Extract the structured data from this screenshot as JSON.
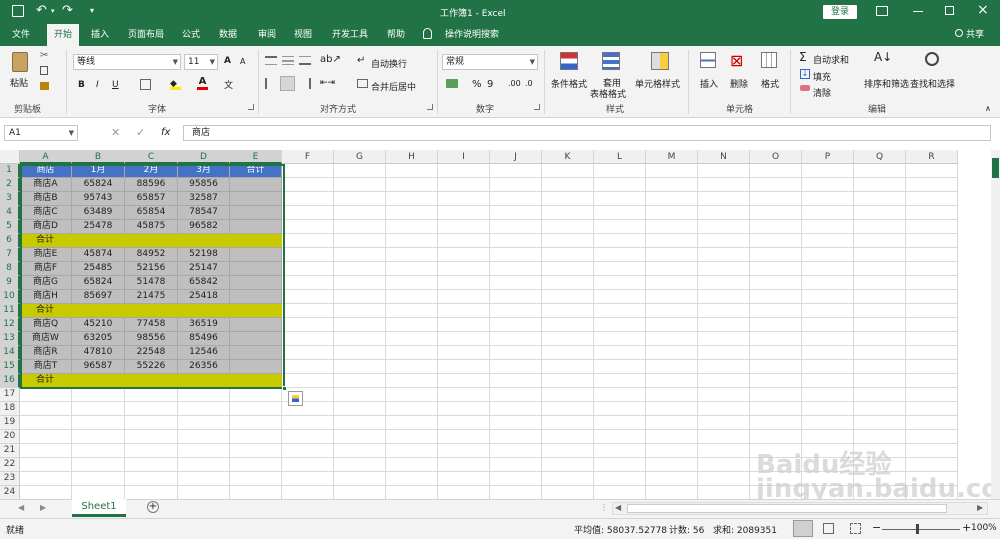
{
  "window": {
    "title": "工作簿1 - Excel",
    "login_label": "登录"
  },
  "ribbon_tabs": [
    "文件",
    "开始",
    "插入",
    "页面布局",
    "公式",
    "数据",
    "审阅",
    "视图",
    "开发工具",
    "帮助"
  ],
  "tell_me": "操作说明搜索",
  "share_label": "共享",
  "clipboard": {
    "paste": "粘贴",
    "group": "剪贴板"
  },
  "font": {
    "name": "等线",
    "size": "11",
    "group": "字体",
    "bold": "B",
    "italic": "I",
    "underline": "U",
    "grow": "A",
    "shrink": "A"
  },
  "alignment": {
    "wrap": "自动换行",
    "merge": "合并后居中",
    "group": "对齐方式"
  },
  "number": {
    "format": "常规",
    "percent": "%",
    "comma": "9",
    "group": "数字"
  },
  "styles": {
    "conditional": "条件格式",
    "table1": "套用",
    "table2": "表格格式",
    "cell": "单元格样式",
    "group": "样式"
  },
  "cells": {
    "insert": "插入",
    "delete": "删除",
    "format": "格式",
    "group": "单元格"
  },
  "editing": {
    "autosum": "自动求和",
    "fill": "填充",
    "clear": "清除",
    "sort": "排序和筛选",
    "find": "查找和选择",
    "group": "编辑"
  },
  "formula_bar": {
    "name_box": "A1",
    "fx": "fx",
    "content": "商店"
  },
  "columns": [
    "A",
    "B",
    "C",
    "D",
    "E",
    "F",
    "G",
    "H",
    "I",
    "J",
    "K",
    "L",
    "M",
    "N",
    "O",
    "P",
    "Q",
    "R"
  ],
  "rows": [
    {
      "n": "1",
      "cells": [
        "商店",
        "1月",
        "2月",
        "3月",
        "合计"
      ],
      "kind": "header"
    },
    {
      "n": "2",
      "cells": [
        "商店A",
        "65824",
        "88596",
        "95856",
        ""
      ],
      "kind": "data"
    },
    {
      "n": "3",
      "cells": [
        "商店B",
        "95743",
        "65857",
        "32587",
        ""
      ],
      "kind": "data"
    },
    {
      "n": "4",
      "cells": [
        "商店C",
        "63489",
        "65854",
        "78547",
        ""
      ],
      "kind": "data"
    },
    {
      "n": "5",
      "cells": [
        "商店D",
        "25478",
        "45875",
        "96582",
        ""
      ],
      "kind": "data"
    },
    {
      "n": "6",
      "cells": [
        "合计",
        "",
        "",
        "",
        ""
      ],
      "kind": "total"
    },
    {
      "n": "7",
      "cells": [
        "商店E",
        "45874",
        "84952",
        "52198",
        ""
      ],
      "kind": "data"
    },
    {
      "n": "8",
      "cells": [
        "商店F",
        "25485",
        "52156",
        "25147",
        ""
      ],
      "kind": "data"
    },
    {
      "n": "9",
      "cells": [
        "商店G",
        "65824",
        "51478",
        "65842",
        ""
      ],
      "kind": "data"
    },
    {
      "n": "10",
      "cells": [
        "商店H",
        "85697",
        "21475",
        "25418",
        ""
      ],
      "kind": "data"
    },
    {
      "n": "11",
      "cells": [
        "合计",
        "",
        "",
        "",
        ""
      ],
      "kind": "total"
    },
    {
      "n": "12",
      "cells": [
        "商店Q",
        "45210",
        "77458",
        "36519",
        ""
      ],
      "kind": "data"
    },
    {
      "n": "13",
      "cells": [
        "商店W",
        "63205",
        "98556",
        "85496",
        ""
      ],
      "kind": "data"
    },
    {
      "n": "14",
      "cells": [
        "商店R",
        "47810",
        "22548",
        "12546",
        ""
      ],
      "kind": "data"
    },
    {
      "n": "15",
      "cells": [
        "商店T",
        "96587",
        "55226",
        "26356",
        ""
      ],
      "kind": "data"
    },
    {
      "n": "16",
      "cells": [
        "合计",
        "",
        "",
        "",
        ""
      ],
      "kind": "total"
    },
    {
      "n": "17",
      "cells": [],
      "kind": "empty"
    },
    {
      "n": "18",
      "cells": [],
      "kind": "empty"
    },
    {
      "n": "19",
      "cells": [],
      "kind": "empty"
    },
    {
      "n": "20",
      "cells": [],
      "kind": "empty"
    },
    {
      "n": "21",
      "cells": [],
      "kind": "empty"
    },
    {
      "n": "22",
      "cells": [],
      "kind": "empty"
    },
    {
      "n": "23",
      "cells": [],
      "kind": "empty"
    },
    {
      "n": "24",
      "cells": [],
      "kind": "empty"
    }
  ],
  "colors": {
    "accent": "#217346",
    "header_fill": "#4472c4",
    "total_fill": "#c9c900",
    "data_fill": "#bfbfbf"
  },
  "sheet_tab": "Sheet1",
  "status": {
    "mode": "就绪",
    "average": "平均值: 58037.52778",
    "count": "计数: 56",
    "sum": "求和: 2089351",
    "zoom": "100%"
  },
  "watermark": "Baidu经验 jingyan.baidu.com"
}
